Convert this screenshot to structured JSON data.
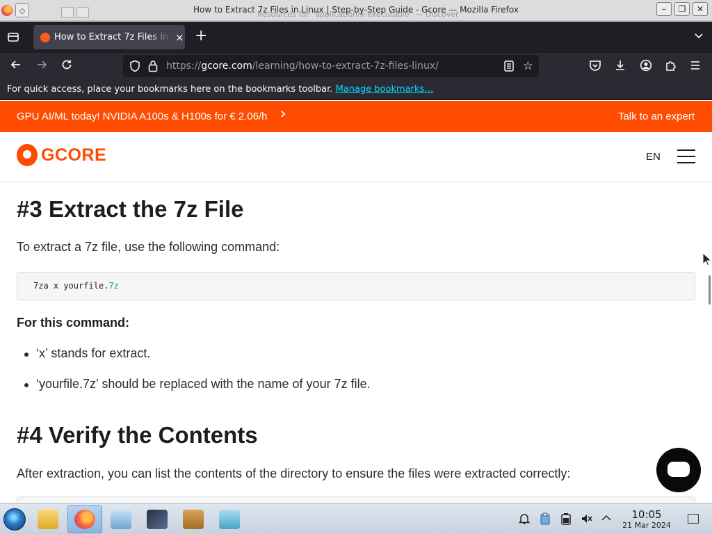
{
  "window": {
    "title": "How to Extract 7z Files in Linux | Step-by-Step Guide - Gcore — Mozilla Firefox",
    "background_notification": "Resources for \"application/x-executable\" — Discover"
  },
  "tabs": [
    {
      "title": "How to Extract 7z Files in Linux | Step-by-Step Guide - Gcore",
      "favicon": "gcore-favicon",
      "active": true
    }
  ],
  "toolbar": {
    "url_prefix": "https://",
    "url_domain": "gcore.com",
    "url_path": "/learning/how-to-extract-7z-files-linux/",
    "new_tab_label": "+",
    "close_tab_label": "×"
  },
  "bookmarks_bar": {
    "message": "For quick access, place your bookmarks here on the bookmarks toolbar.",
    "link": "Manage bookmarks…"
  },
  "promo": {
    "text": "GPU AI/ML today! NVIDIA A100s & H100s for € 2.06/h",
    "chevron": "›",
    "cta": "Talk to an expert",
    "color": "#ff4c00"
  },
  "site_header": {
    "logo_text": "GCORE",
    "language": "EN",
    "brand_color": "#ff4c00"
  },
  "article": {
    "heading_3": "#3 Extract the 7z File",
    "intro_3": "To extract a 7z file, use the following command:",
    "code_cmd": "7za x yourfile.",
    "code_ext": "7z",
    "for_this": "For this command:",
    "bullets": [
      "‘x’ stands for extract.",
      "‘yourfile.7z’ should be replaced with the name of your 7z file."
    ],
    "heading_4": "#4 Verify the Contents",
    "intro_4": "After extraction, you can list the contents of the directory to ensure the files were extracted correctly:"
  },
  "taskbar": {
    "apps": [
      "file-manager",
      "firefox",
      "system-settings",
      "software-center",
      "package-installer",
      "network-tool"
    ],
    "clock_time": "10:05",
    "clock_date": "21 Mar 2024"
  }
}
